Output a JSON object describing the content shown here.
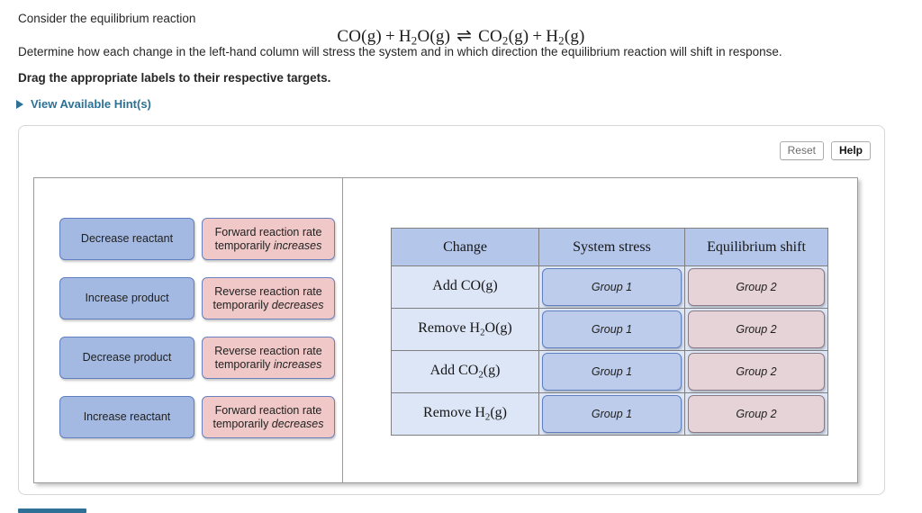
{
  "prompt": {
    "intro": "Consider the equilibrium reaction",
    "equation": {
      "reactant_1": "CO(g)",
      "plus_1": "+",
      "reactant_2_base": "H",
      "reactant_2_sub": "2",
      "reactant_2_tail": "O(g)",
      "arrow": "⇌",
      "product_1_base": "CO",
      "product_1_sub": "2",
      "product_1_tail": "(g)",
      "plus_2": "+",
      "product_2_base": "H",
      "product_2_sub": "2",
      "product_2_tail": "(g)",
      "plain_text": "CO(g) + H2O(g) ⇌ CO2(g) + H2(g)"
    },
    "determine": "Determine how each change in the left-hand column will stress the system and in which direction the equilibrium reaction will shift in response.",
    "drag_instruction": "Drag the appropriate labels to their respective targets."
  },
  "hint": {
    "label": "View Available Hint(s)",
    "triangle_icon": "triangle-right-icon",
    "color": "#2c7296"
  },
  "toolbar": {
    "reset_label": "Reset",
    "help_label": "Help"
  },
  "label_bank": {
    "blue_labels": [
      {
        "text": "Decrease reactant"
      },
      {
        "text": "Increase product"
      },
      {
        "text": "Decrease product"
      },
      {
        "text": "Increase reactant"
      }
    ],
    "pink_labels": [
      {
        "line1": "Forward reaction rate",
        "line2_prefix": "temporarily ",
        "line2_em": "increases"
      },
      {
        "line1": "Reverse reaction rate",
        "line2_prefix": "temporarily ",
        "line2_em": "decreases"
      },
      {
        "line1": "Reverse reaction rate",
        "line2_prefix": "temporarily ",
        "line2_em": "increases"
      },
      {
        "line1": "Forward reaction rate",
        "line2_prefix": "temporarily ",
        "line2_em": "decreases"
      }
    ]
  },
  "target_table": {
    "headers": [
      "Change",
      "System stress",
      "Equilibrium shift"
    ],
    "rows": [
      {
        "change": {
          "prefix": "Add CO",
          "sub": "",
          "suffix": "(g)",
          "plain": "Add CO(g)"
        },
        "stress_placeholder": "Group 1",
        "shift_placeholder": "Group 2"
      },
      {
        "change": {
          "prefix": "Remove H",
          "sub": "2",
          "suffix": "O(g)",
          "plain": "Remove H2O(g)"
        },
        "stress_placeholder": "Group 1",
        "shift_placeholder": "Group 2"
      },
      {
        "change": {
          "prefix": "Add CO",
          "sub": "2",
          "suffix": "(g)",
          "plain": "Add CO2(g)"
        },
        "stress_placeholder": "Group 1",
        "shift_placeholder": "Group 2"
      },
      {
        "change": {
          "prefix": "Remove H",
          "sub": "2",
          "suffix": "(g)",
          "plain": "Remove H2(g)"
        },
        "stress_placeholder": "Group 1",
        "shift_placeholder": "Group 2"
      }
    ]
  },
  "colors": {
    "chip_blue_fill": "#a3b9e2",
    "chip_blue_border": "#5f7fc0",
    "chip_pink_fill": "#f0c8c8",
    "chip_pink_border": "#6980bd",
    "table_header_fill": "#b4c6e9",
    "table_cell_fill": "#dde6f6",
    "drop_blue_fill": "#bdcceb",
    "drop_pink_fill": "#e5d3d8",
    "accent_teal": "#2c7296"
  }
}
